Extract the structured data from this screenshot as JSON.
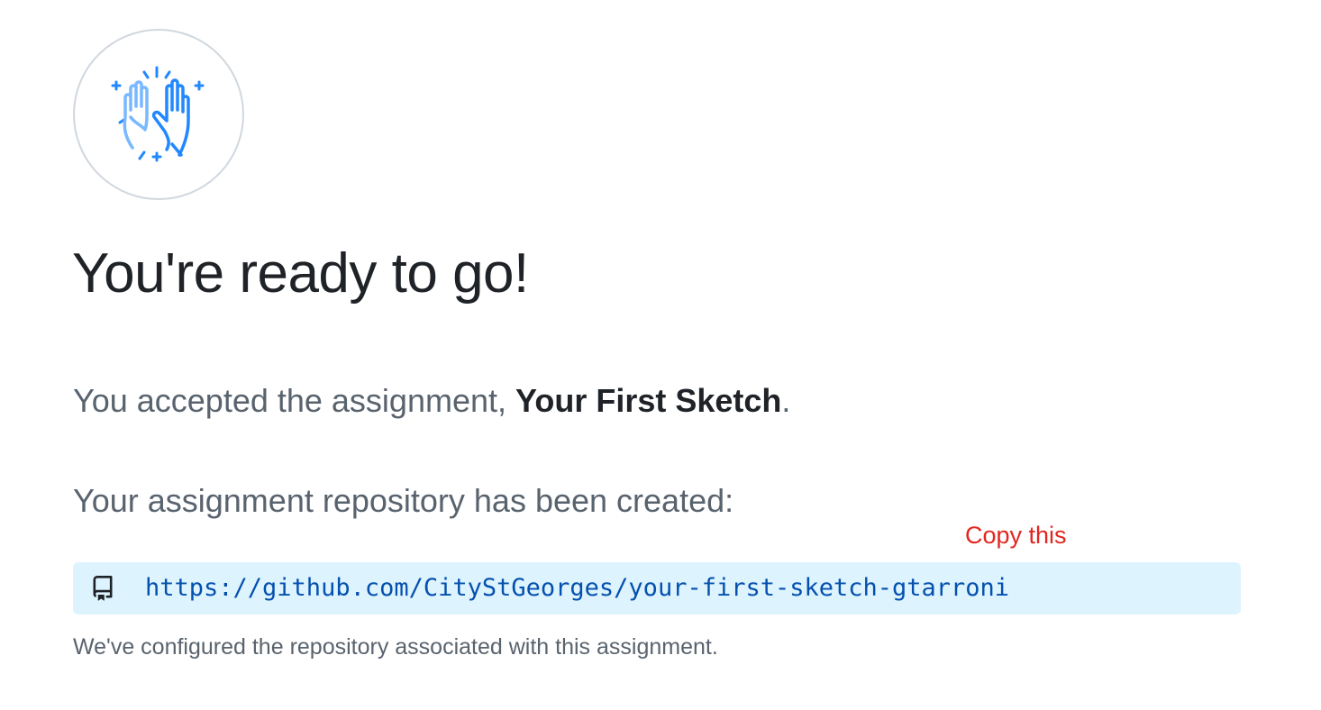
{
  "hero": {
    "icon": "high-five-icon",
    "title": "You're ready to go!"
  },
  "assignment": {
    "prefix": "You accepted the assignment, ",
    "name": "Your First Sketch",
    "suffix": "."
  },
  "repository": {
    "heading": "Your assignment repository has been created:",
    "icon": "repo-icon",
    "url": "https://github.com/CityStGeorges/your-first-sketch-gtarroni",
    "note": "We've configured the repository associated with this assignment."
  },
  "annotation": {
    "text": "Copy this",
    "color": "#e3261f"
  },
  "colors": {
    "link": "#0550ae",
    "link_box_bg": "#ddf4ff",
    "icon_blue": "#2188ff",
    "icon_light_blue": "#79b8ff",
    "muted_text": "#59636e"
  }
}
